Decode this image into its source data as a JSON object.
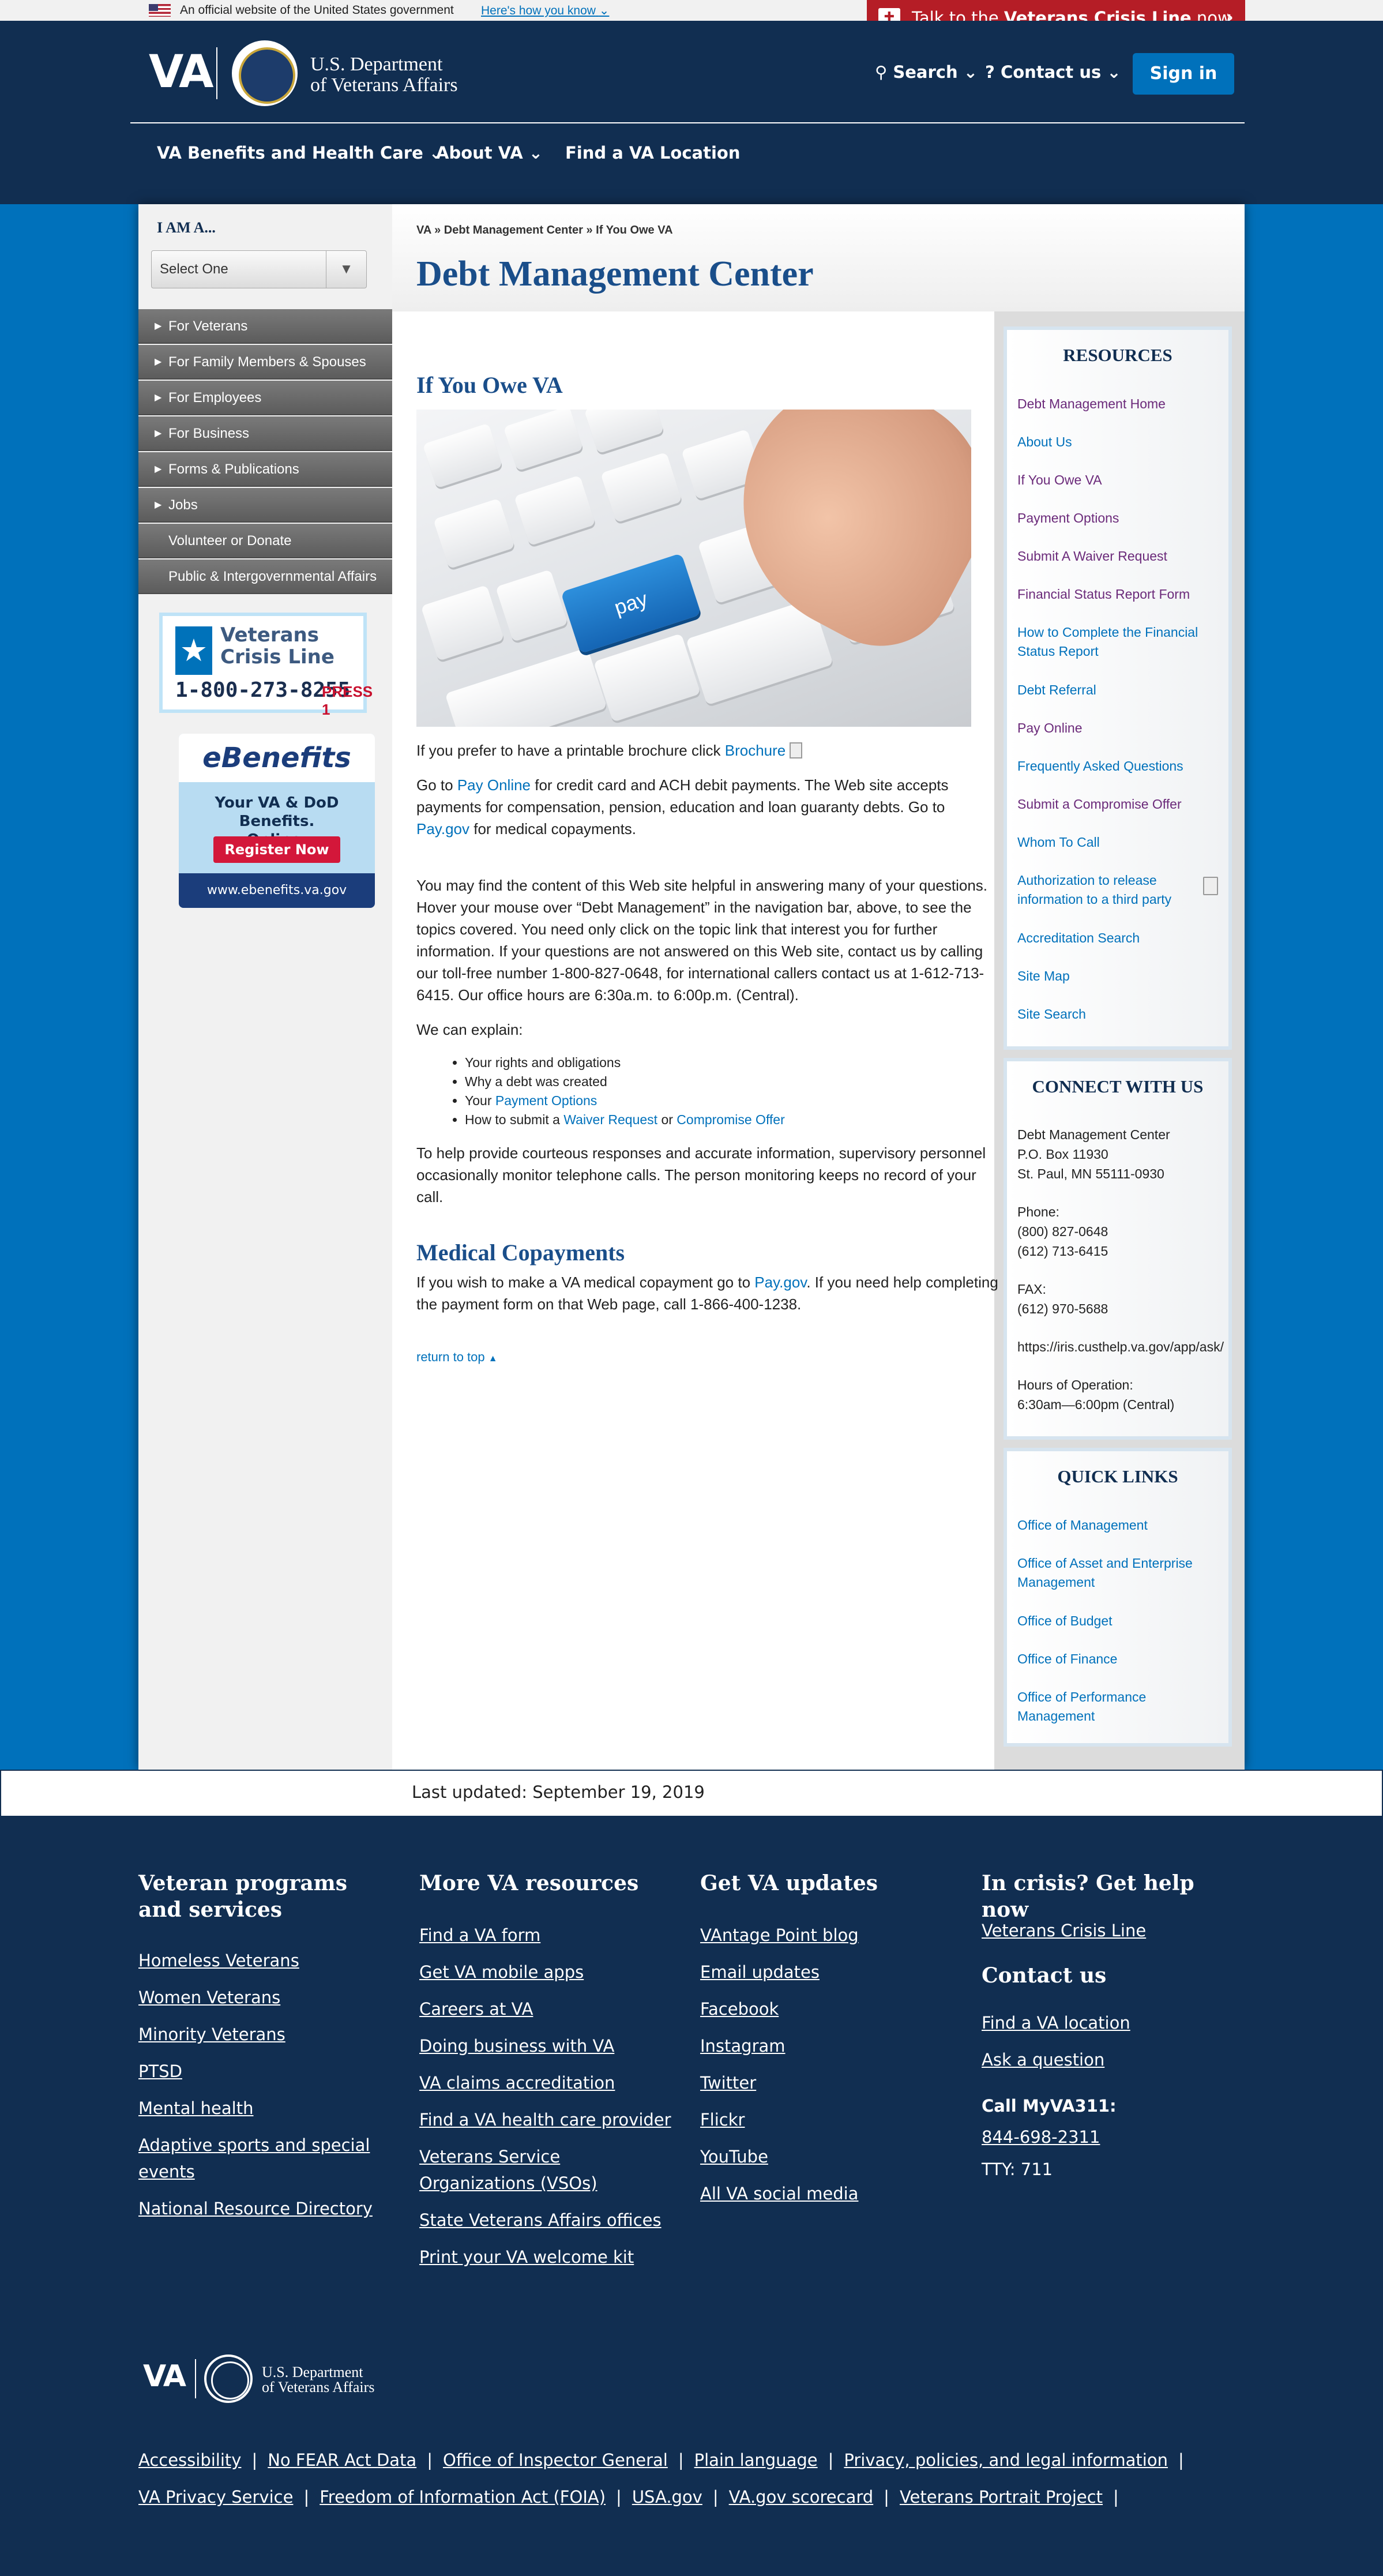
{
  "official_banner": {
    "text": "An official website of the United States government",
    "link": "Here's how you know"
  },
  "crisis_bar": {
    "prefix": "Talk to the ",
    "bold": "Veterans Crisis Line",
    "suffix": " now"
  },
  "header": {
    "logo": "VA",
    "dept_line1": "U.S. Department",
    "dept_line2": "of Veterans Affairs",
    "search": "Search",
    "contact": "Contact us",
    "signin": "Sign in",
    "nav": [
      "VA Benefits and Health Care",
      "About VA",
      "Find a VA Location"
    ]
  },
  "left": {
    "iam": "I AM A...",
    "select": "Select One",
    "nav": [
      "For Veterans",
      "For Family Members & Spouses",
      "For Employees",
      "For Business",
      "Forms & Publications",
      "Jobs",
      "Volunteer or Donate",
      "Public & Intergovernmental Affairs"
    ],
    "vcl_line1": "Veterans",
    "vcl_line2": "Crisis Line",
    "vcl_phone": "1-800-273-8255",
    "vcl_press": "PRESS 1",
    "ebenefits": "eBenefits",
    "ebenefits_sub1": "Your VA & DoD Benefits.",
    "ebenefits_sub2": "Online.",
    "ebenefits_register": "Register Now",
    "ebenefits_url": "www.ebenefits.va.gov"
  },
  "breadcrumb": "VA » Debt Management Center » If You Owe VA",
  "page_title": "Debt Management Center",
  "main": {
    "h_owe": "If You Owe VA",
    "image_key": "pay",
    "brochure_pre": "If you prefer to have a printable brochure click ",
    "brochure_link": "Brochure",
    "p1_a": "Go to ",
    "p1_link1": "Pay Online",
    "p1_b": " for credit card and ACH debit payments.  The Web site accepts payments for compensation, pension, education and loan guaranty debts.  Go to ",
    "p1_link2": "Pay.gov",
    "p1_c": " for medical copayments.",
    "p2": "You may find the content of this Web site helpful in answering many of your questions.  Hover your mouse over “Debt Management” in the navigation bar, above, to see the topics covered.  You need only click on the topic link that interest you for further information.  If your questions are not answered on this Web site, contact us by calling our toll-free number 1-800-827-0648, for international callers contact us at 1-612-713-6415.  Our office hours are 6:30a.m. to 6:00p.m. (Central).",
    "explain": "We can explain:",
    "li1": "Your rights and obligations",
    "li2": "Why a debt was created",
    "li3_pre": "Your ",
    "li3_link": "Payment Options",
    "li4_pre": "How to submit a ",
    "li4_link1": "Waiver Request",
    "li4_mid": " or ",
    "li4_link2": "Compromise Offer",
    "p3": "To help provide courteous responses and accurate information, supervisory personnel occasionally monitor telephone calls.  The person monitoring keeps no record of your call.",
    "h_med": "Medical Copayments",
    "p4_a": "If you wish to make a VA medical copayment go to ",
    "p4_link": "Pay.gov",
    "p4_b": ".  If you need help completing the payment form on that Web page, call 1-866-400-1238.",
    "return_top": "return to top"
  },
  "resources": {
    "title": "RESOURCES",
    "links": [
      "Debt Management Home",
      "About Us",
      "If You Owe VA",
      "Payment Options",
      "Submit A Waiver Request",
      "Financial Status Report Form",
      "How to Complete the Financial Status Report",
      "Debt Referral",
      "Pay Online",
      "Frequently Asked Questions",
      "Submit a Compromise Offer",
      "Whom To Call",
      "Authorization to release information to a third party",
      "Accreditation Search",
      "Site Map",
      "Site Search"
    ]
  },
  "connect": {
    "title": "CONNECT WITH US",
    "addr1": "Debt Management Center",
    "addr2": "P.O. Box 11930",
    "addr3": "St. Paul, MN 55111-0930",
    "phone_label": "Phone:",
    "phone1": "(800) 827-0648",
    "phone2": "(612) 713-6415",
    "fax_label": "FAX:",
    "fax": "(612) 970-5688",
    "url": "https://iris.custhelp.va.gov/app/ask/",
    "hours_label": "Hours of Operation:",
    "hours": "6:30am—6:00pm (Central)"
  },
  "quicklinks": {
    "title": "QUICK LINKS",
    "links": [
      "Office of Management",
      "Office of Asset and Enterprise Management",
      "Office of Budget",
      "Office of Finance",
      "Office of Performance Management"
    ]
  },
  "last_updated": "Last updated: September 19, 2019",
  "footer": {
    "col1_title": "Veteran programs and services",
    "col1": [
      "Homeless Veterans",
      "Women Veterans",
      "Minority Veterans",
      "PTSD",
      "Mental health",
      "Adaptive sports and special events",
      "National Resource Directory"
    ],
    "col2_title": "More VA resources",
    "col2": [
      "Find a VA form",
      "Get VA mobile apps",
      "Careers at VA",
      "Doing business with VA",
      "VA claims accreditation",
      "Find a VA health care provider",
      "Veterans Service Organizations (VSOs)",
      "State Veterans Affairs offices",
      "Print your VA welcome kit"
    ],
    "col3_title": "Get VA updates",
    "col3": [
      "VAntage Point blog",
      "Email updates",
      "Facebook",
      "Instagram",
      "Twitter",
      "Flickr",
      "YouTube",
      "All VA social media"
    ],
    "col4_title": "In crisis? Get help now",
    "col4_link": "Veterans Crisis Line",
    "contact_title": "Contact us",
    "contact": [
      "Find a VA location",
      "Ask a question"
    ],
    "myva": "Call MyVA311:",
    "myva_phone": "844-698-2311",
    "tty": "TTY: 711",
    "logo": "VA",
    "dept_line1": "U.S. Department",
    "dept_line2": "of Veterans Affairs",
    "bottom_row1": [
      "Accessibility",
      "No FEAR Act Data",
      "Office of Inspector General",
      "Plain language",
      "Privacy, policies, and legal information"
    ],
    "bottom_row2": [
      "VA Privacy Service",
      "Freedom of Information Act (FOIA)",
      "USA.gov",
      "VA.gov scorecard",
      "Veterans Portrait Project"
    ],
    "separator": "|"
  },
  "colors": {
    "navy": "#112e51",
    "va_blue": "#0071bb",
    "crisis_red": "#b51d26",
    "link_purple": "#6b2a7a"
  }
}
